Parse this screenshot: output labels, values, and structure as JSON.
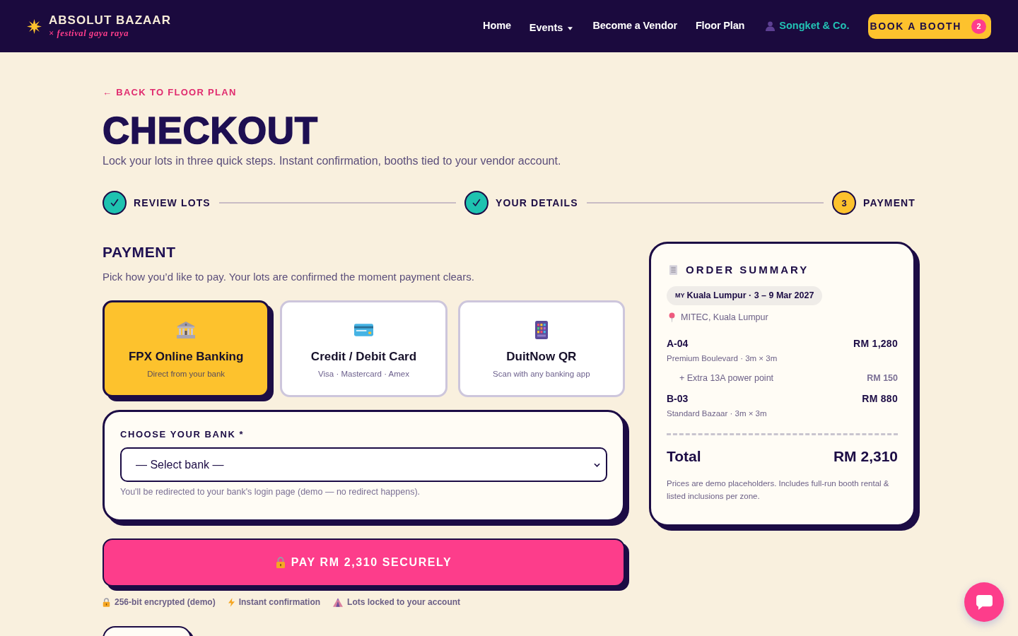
{
  "brand": {
    "name": "ABSOLUT BAZAAR",
    "tagline": "× festival gaya raya"
  },
  "nav": {
    "links": [
      {
        "label": "Home",
        "kind": "link"
      },
      {
        "label": "Events",
        "kind": "dropdown"
      },
      {
        "label": "Become a Vendor",
        "kind": "link"
      },
      {
        "label": "Floor Plan",
        "kind": "link"
      }
    ],
    "account": {
      "label": "Songket & Co."
    },
    "cta": {
      "label": "BOOK A BOOTH",
      "count": "2"
    }
  },
  "back_link": "← BACK TO FLOOR PLAN",
  "page_title": "CHECKOUT",
  "intro": "Lock your lots in three quick steps. Instant confirmation, booths tied to your vendor account.",
  "steps": [
    {
      "label": "REVIEW LOTS",
      "completed": true,
      "selected": false
    },
    {
      "label": "YOUR DETAILS",
      "completed": true,
      "selected": false
    },
    {
      "label": "PAYMENT",
      "number": "3",
      "completed": false,
      "selected": true
    }
  ],
  "payment": {
    "heading": "PAYMENT",
    "description": "Pick how you’d like to pay. Your lots are confirmed the moment payment clears.",
    "methods": [
      {
        "title": "FPX Online Banking",
        "subtitle": "Direct from your bank",
        "selected": true
      },
      {
        "title": "Credit / Debit Card",
        "subtitle": "Visa · Mastercard · Amex",
        "selected": false
      },
      {
        "title": "DuitNow QR",
        "subtitle": "Scan with any banking app",
        "selected": false
      }
    ],
    "bank": {
      "label": "CHOOSE YOUR BANK *",
      "placeholder": "— Select bank —",
      "hint": "You'll be redirected to your bank's login page (demo — no redirect happens)."
    },
    "pay_button": "PAY RM 2,310 SECURELY",
    "assurances": [
      {
        "label": "256-bit encrypted (demo)"
      },
      {
        "label": "Instant confirmation"
      },
      {
        "label": "Lots locked to your account"
      }
    ]
  },
  "summary": {
    "title": "ORDER SUMMARY",
    "event": {
      "flag": "MY",
      "label": "Kuala Lumpur · 3 – 9 Mar 2027"
    },
    "venue": "MITEC, Kuala Lumpur",
    "lines": [
      {
        "kind": "lot",
        "code": "A-04",
        "price": "RM 1,280",
        "detail": "Premium Boulevard · 3m × 3m"
      },
      {
        "kind": "addon",
        "label": "+ Extra 13A power point",
        "price": "RM 150"
      },
      {
        "kind": "lot",
        "code": "B-03",
        "price": "RM 880",
        "detail": "Standard Bazaar · 3m × 3m"
      }
    ],
    "total_label": "Total",
    "total": "RM 2,310",
    "note": "Prices are demo placeholders. Includes full-run booth rental & listed inclusions per zone."
  }
}
